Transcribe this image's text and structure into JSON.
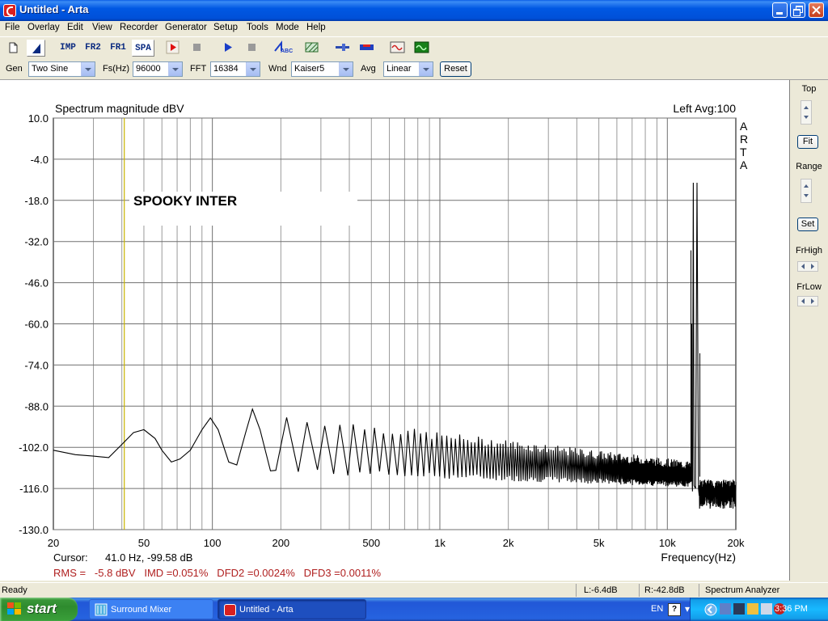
{
  "window": {
    "title": "Untitled - Arta",
    "accent": "#0058e3"
  },
  "menu": [
    "File",
    "Overlay",
    "Edit",
    "View",
    "Recorder",
    "Generator",
    "Setup",
    "Tools",
    "Mode",
    "Help"
  ],
  "toolbar": {
    "buttons": [
      {
        "name": "new-icon"
      },
      {
        "name": "open-icon",
        "pressed": true
      },
      {
        "name": "impulse-button",
        "label": "IMP"
      },
      {
        "name": "freq-response-2ch-button",
        "label": "FR2"
      },
      {
        "name": "freq-response-1ch-button",
        "label": "FR1"
      },
      {
        "name": "spectrum-analyzer-button",
        "label": "SPA",
        "pressed": true
      },
      {
        "name": "record-icon"
      },
      {
        "name": "stop-icon"
      },
      {
        "name": "play-icon"
      },
      {
        "name": "stop2-icon"
      },
      {
        "name": "abc-icon"
      },
      {
        "name": "pattern-icon"
      },
      {
        "name": "slider-icon"
      },
      {
        "name": "levels-icon"
      },
      {
        "name": "generator-icon"
      },
      {
        "name": "scope-icon"
      }
    ]
  },
  "controls": {
    "gen_label": "Gen",
    "gen_value": "Two Sine",
    "fs_label": "Fs(Hz)",
    "fs_value": "96000",
    "fft_label": "FFT",
    "fft_value": "16384",
    "wnd_label": "Wnd",
    "wnd_value": "Kaiser5",
    "avg_label": "Avg",
    "avg_value": "Linear",
    "reset_label": "Reset"
  },
  "chart_data": {
    "type": "line",
    "title": "Spectrum magnitude dBV",
    "channel_info": "Left  Avg:100",
    "side_label": [
      "A",
      "R",
      "T",
      "A"
    ],
    "annotation": "SPOOKY INTER",
    "xlabel": "Frequency(Hz)",
    "x_scale": "log",
    "xlim": [
      20,
      20000
    ],
    "ylim": [
      -130,
      10
    ],
    "yticks": [
      "10.0",
      "-4.0",
      "-18.0",
      "-32.0",
      "-46.0",
      "-60.0",
      "-74.0",
      "-88.0",
      "-102.0",
      "-116.0",
      "-130.0"
    ],
    "ytick_values": [
      10,
      -4,
      -18,
      -32,
      -46,
      -60,
      -74,
      -88,
      -102,
      -116,
      -130
    ],
    "xtick_labels": [
      "20",
      "50",
      "100",
      "200",
      "500",
      "1k",
      "2k",
      "5k",
      "10k",
      "20k"
    ],
    "xtick_values": [
      20,
      50,
      100,
      200,
      500,
      1000,
      2000,
      5000,
      10000,
      20000
    ],
    "cursor_freq": 41,
    "peaks": [
      {
        "x": 13000,
        "y": -12
      },
      {
        "x": 13500,
        "y": -12
      }
    ],
    "envelope": [
      {
        "x": 20,
        "y": -103
      },
      {
        "x": 25,
        "y": -104.5
      },
      {
        "x": 30,
        "y": -105
      },
      {
        "x": 35,
        "y": -105.5
      },
      {
        "x": 40,
        "y": -101
      },
      {
        "x": 45,
        "y": -97
      },
      {
        "x": 50,
        "y": -96
      },
      {
        "x": 56,
        "y": -99
      },
      {
        "x": 60,
        "y": -103
      },
      {
        "x": 66,
        "y": -107
      },
      {
        "x": 72,
        "y": -106
      },
      {
        "x": 80,
        "y": -103
      },
      {
        "x": 90,
        "y": -96
      },
      {
        "x": 98,
        "y": -92
      },
      {
        "x": 106,
        "y": -96
      },
      {
        "x": 118,
        "y": -107
      },
      {
        "x": 128,
        "y": -108
      },
      {
        "x": 140,
        "y": -97
      },
      {
        "x": 150,
        "y": -89
      },
      {
        "x": 162,
        "y": -96
      },
      {
        "x": 180,
        "y": -110
      }
    ],
    "colors": {
      "trace": "#000000",
      "grid": "#9a9a9a",
      "cursor": "#c8b400",
      "rms": "#b02020"
    }
  },
  "cursor_readout": {
    "label": "Cursor:",
    "value": "41.0 Hz, -99.58 dB"
  },
  "measurements": "RMS =   -5.8 dBV   IMD =0.051%   DFD2 =0.0024%   DFD3 =0.0011%",
  "side_panel": {
    "top_label": "Top",
    "fit_label": "Fit",
    "range_label": "Range",
    "set_label": "Set",
    "frhigh_label": "FrHigh",
    "frlow_label": "FrLow"
  },
  "status": {
    "ready": "Ready",
    "left_level": "L:-6.4dB",
    "right_level": "R:-42.8dB",
    "mode": "Spectrum Analyzer"
  },
  "taskbar": {
    "start_label": "start",
    "tasks": [
      {
        "label": "Surround Mixer",
        "active": false
      },
      {
        "label": "Untitled - Arta",
        "active": true
      }
    ],
    "lang": "EN",
    "clock": "3:36 PM"
  }
}
